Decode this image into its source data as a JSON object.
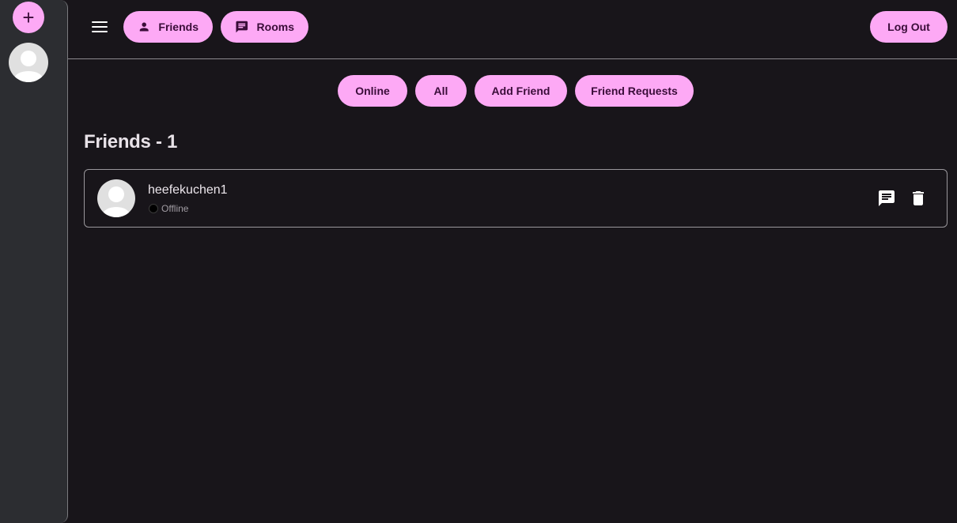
{
  "rail": {
    "add_label": "+",
    "avatar_icon": "default-avatar-icon"
  },
  "topbar": {
    "menu_icon": "hamburger-menu-icon",
    "friends_label": "Friends",
    "friends_icon": "person-icon",
    "rooms_label": "Rooms",
    "rooms_icon": "chat-bubble-icon",
    "logout_label": "Log Out"
  },
  "filters": {
    "online": "Online",
    "all": "All",
    "add_friend": "Add Friend",
    "friend_requests": "Friend Requests"
  },
  "friends_section": {
    "title": "Friends - 1",
    "friends": [
      {
        "username": "heefekuchen1",
        "status": "Offline",
        "status_color": "#000000"
      }
    ]
  },
  "colors": {
    "accent": "#fda9f5",
    "accent_text": "#3a0d39",
    "background": "#18151a",
    "rail": "#2c2d31"
  }
}
